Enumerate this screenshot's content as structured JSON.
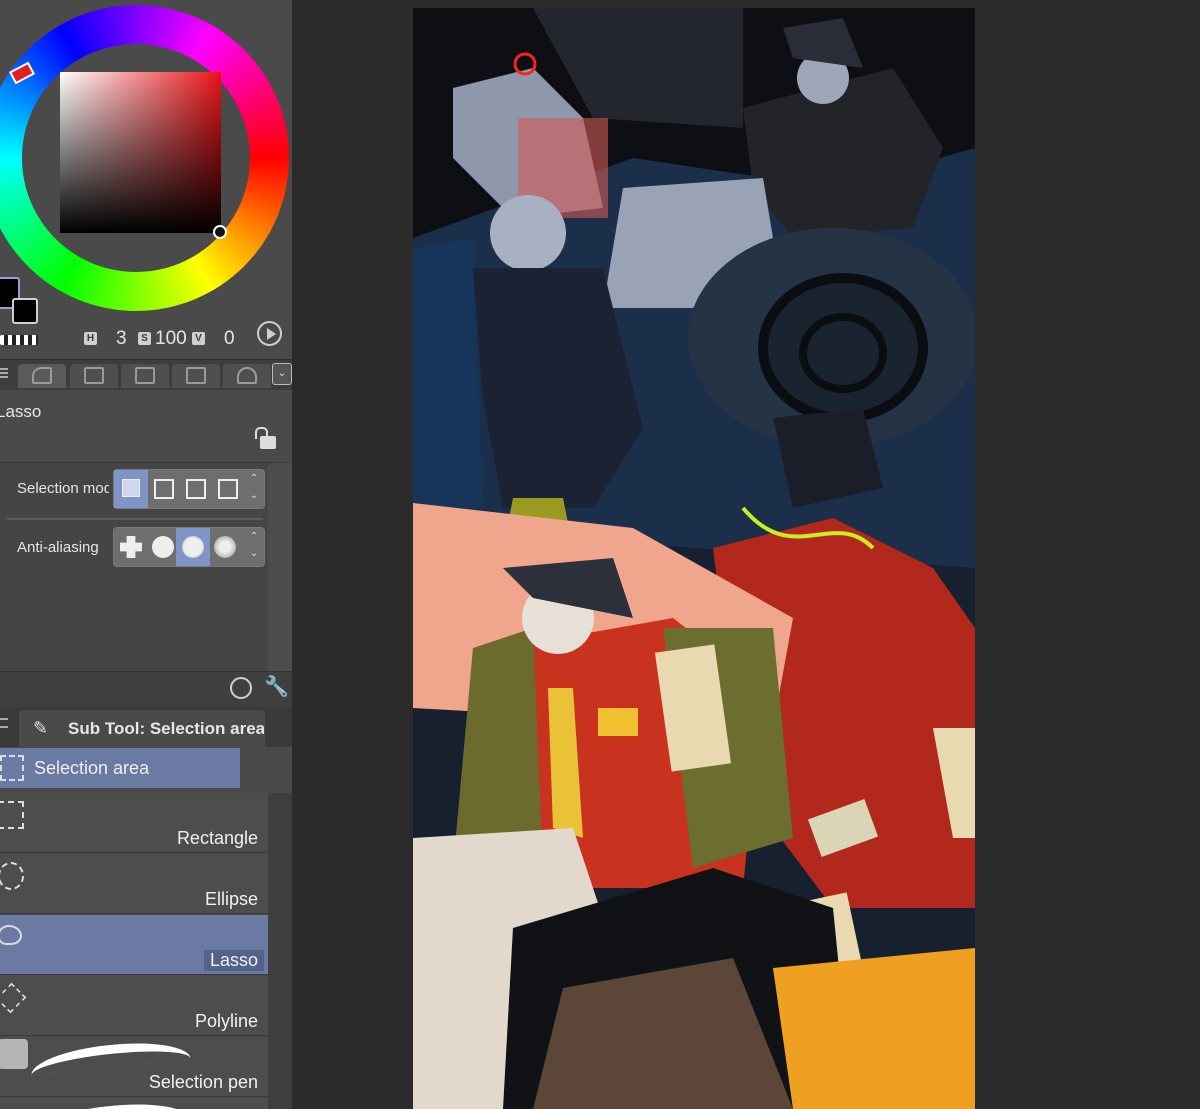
{
  "color": {
    "hsv": {
      "h_label": "H",
      "h": "3",
      "s_label": "S",
      "s": "100",
      "v_label": "V",
      "v": "0"
    },
    "main_color": "#000000",
    "sub_color": "#000000",
    "hue_color": "#e8141a"
  },
  "tool_property": {
    "tool_name": "Lasso",
    "selection_mode_label": "Selection mode",
    "anti_aliasing_label": "Anti-aliasing"
  },
  "sub_tool": {
    "title": "Sub Tool: Selection area",
    "group_label": "Selection area",
    "items": [
      {
        "label": "Rectangle",
        "icon": "rectangle-select-icon"
      },
      {
        "label": "Ellipse",
        "icon": "ellipse-select-icon"
      },
      {
        "label": "Lasso",
        "icon": "lasso-icon",
        "selected": true
      },
      {
        "label": "Polyline",
        "icon": "polyline-icon"
      },
      {
        "label": "Selection pen",
        "icon": "selection-pen-icon"
      }
    ]
  },
  "colors": {
    "panel_bg": "#4a4a4a",
    "canvas_bg": "#2b2b2b",
    "accent": "#6a7aa3"
  }
}
